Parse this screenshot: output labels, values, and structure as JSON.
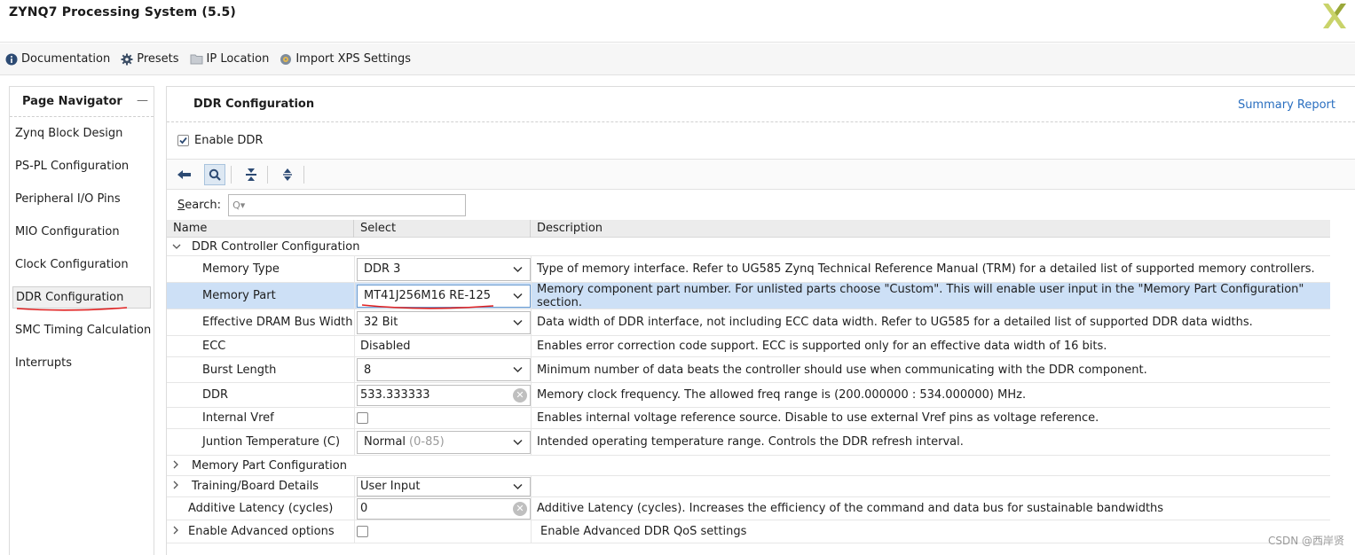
{
  "window": {
    "title": "ZYNQ7 Processing System (5.5)"
  },
  "toolbar": {
    "documentation": "Documentation",
    "presets": "Presets",
    "ip_location": "IP Location",
    "import_xps": "Import XPS Settings"
  },
  "navigator": {
    "title": "Page Navigator",
    "minimize": "—",
    "items": [
      {
        "label": "Zynq Block Design"
      },
      {
        "label": "PS-PL Configuration"
      },
      {
        "label": "Peripheral I/O Pins"
      },
      {
        "label": "MIO Configuration"
      },
      {
        "label": "Clock Configuration"
      },
      {
        "label": "DDR Configuration",
        "active": true
      },
      {
        "label": "SMC Timing Calculation"
      },
      {
        "label": "Interrupts"
      }
    ]
  },
  "main": {
    "title": "DDR Configuration",
    "summary_link": "Summary Report",
    "enable_ddr": {
      "label": "Enable DDR",
      "checked": true
    },
    "search": {
      "label_prefix": "S",
      "label_rest": "earch:",
      "placeholder": "Q▾"
    },
    "table": {
      "headers": [
        "Name",
        "Select",
        "Description"
      ],
      "group_controller": "DDR Controller Configuration",
      "rows": {
        "memory_type": {
          "name": "Memory Type",
          "value": "DDR 3",
          "desc": "Type of memory interface. Refer to UG585 Zynq Technical Reference Manual (TRM) for a detailed list of supported memory controllers."
        },
        "memory_part": {
          "name": "Memory Part",
          "value": "MT41J256M16 RE-125",
          "desc": "Memory component part number. For unlisted parts choose \"Custom\". This will enable user input in the \"Memory Part Configuration\" section."
        },
        "bus_width": {
          "name": "Effective DRAM Bus Width",
          "value": "32 Bit",
          "desc": "Data width of DDR interface, not including ECC data width. Refer to UG585 for a detailed list of supported DDR data widths."
        },
        "ecc": {
          "name": "ECC",
          "value": "Disabled",
          "desc": "Enables error correction code support. ECC is supported only for an effective data width of 16 bits."
        },
        "burst": {
          "name": "Burst Length",
          "value": "8",
          "desc": "Minimum number of data beats the controller should use when communicating with the DDR component."
        },
        "ddr": {
          "name": "DDR",
          "value": "533.333333",
          "desc": "Memory clock frequency. The allowed freq range is (200.000000 : 534.000000) MHz."
        },
        "vref": {
          "name": "Internal Vref",
          "checked": false,
          "desc": "Enables internal voltage reference source. Disable to use external Vref pins as voltage reference."
        },
        "temp": {
          "name": "Juntion Temperature (C)",
          "value": "Normal",
          "hint": "(0-85)",
          "desc": "Intended operating temperature range. Controls the DDR refresh interval."
        },
        "mem_part_cfg": {
          "name": "Memory Part Configuration"
        },
        "training": {
          "name": "Training/Board Details",
          "value": "User Input"
        },
        "additive": {
          "name": "Additive Latency (cycles)",
          "value": "0",
          "desc": "Additive Latency (cycles). Increases the efficiency of the command and data bus for sustainable bandwidths"
        },
        "advanced": {
          "name": "Enable Advanced options",
          "checked": false,
          "desc": "Enable Advanced DDR QoS settings"
        }
      }
    }
  },
  "watermark": "CSDN @西岸贤",
  "colors": {
    "selected_row": "#cde0f6",
    "link": "#2a6fc0",
    "annotation_red": "#e02020"
  }
}
